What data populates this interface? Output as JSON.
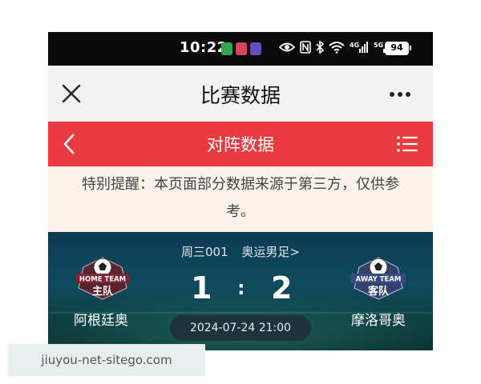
{
  "status_bar": {
    "time": "10:22",
    "battery": "94"
  },
  "title_bar": {
    "title": "比赛数据"
  },
  "section_header": {
    "title": "对阵数据"
  },
  "notice": {
    "text": "特别提醒：本页面部分数据来源于第三方，仅供参考。"
  },
  "match": {
    "match_code": "周三001",
    "competition": "奥运男足>",
    "home_team": {
      "name": "阿根廷奥",
      "badge_top": "HOME TEAM",
      "badge_label": "主队",
      "score": "1"
    },
    "away_team": {
      "name": "摩洛哥奥",
      "badge_top": "AWAY TEAM",
      "badge_label": "客队",
      "score": "2"
    },
    "separator": ":",
    "datetime": "2024-07-24 21:00"
  },
  "watermark": {
    "text": "jiuyou-net-sitego.com"
  },
  "colors": {
    "accent_red": "#ea3b43",
    "notice_bg": "#fbf3ea",
    "match_bg": "#0f4a5e"
  },
  "icons": {
    "close": "close-icon",
    "more": "more-icon",
    "back": "chevron-left-icon",
    "list": "list-icon"
  }
}
